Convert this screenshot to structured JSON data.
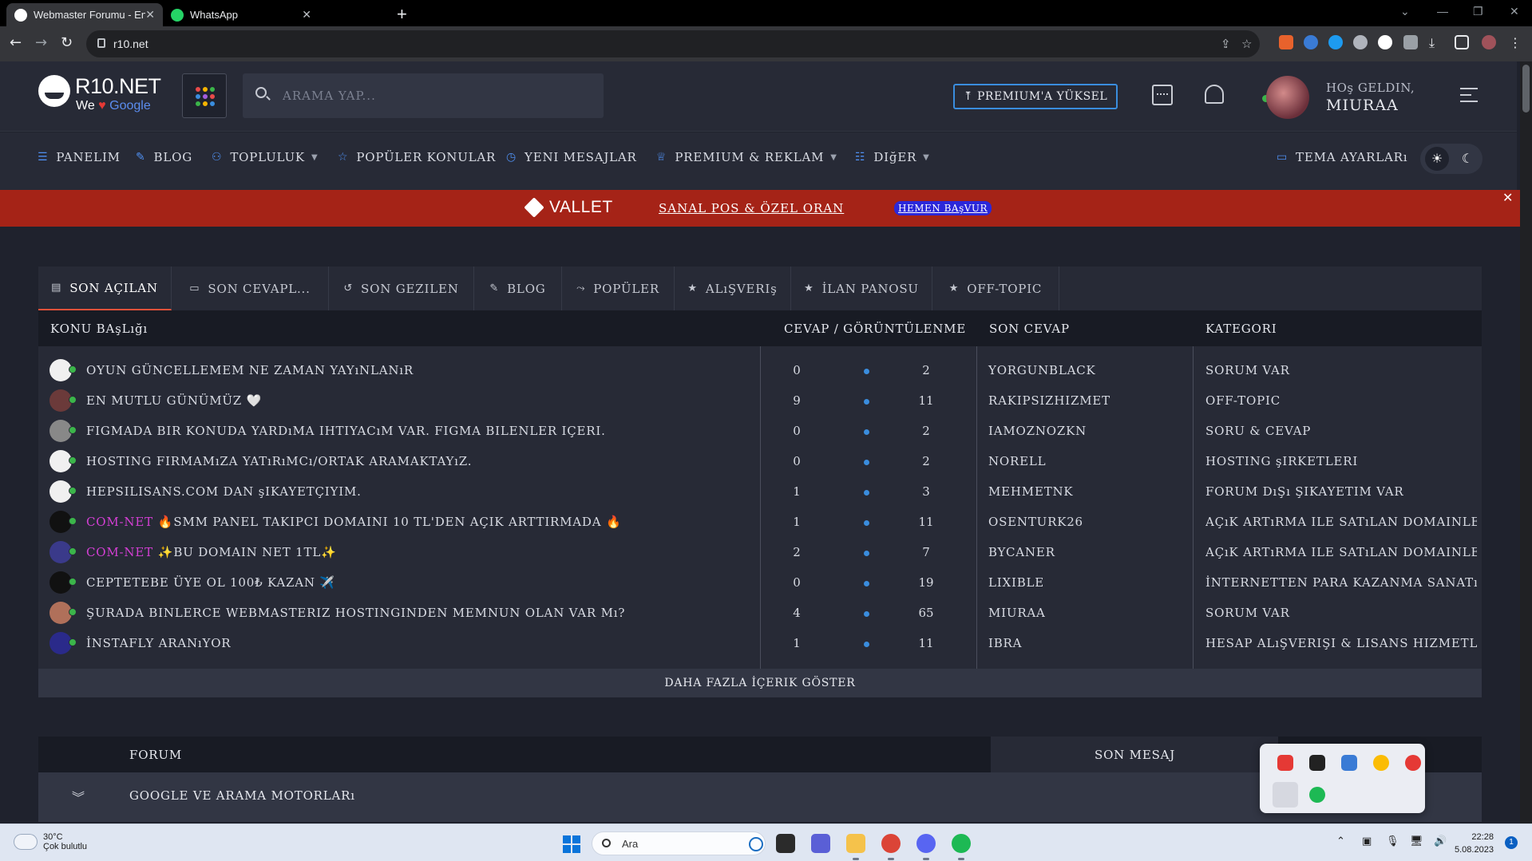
{
  "browser": {
    "tabs": [
      {
        "title": "Webmaster Forumu - En Büyük F",
        "active": true
      },
      {
        "title": "WhatsApp",
        "active": false
      }
    ],
    "address": "r10.net"
  },
  "site": {
    "logo": {
      "name": "R10.NET",
      "tagline_pre": "We",
      "tagline_heart": "♥",
      "tagline_post": "Google"
    },
    "search_placeholder": "ARAMA YAP...",
    "premium_button": "⤒ PREMIUM'A YÜKSEL",
    "greeting": "HOş GELDIN,",
    "username": "MIURAA"
  },
  "nav": {
    "items": [
      {
        "icon": "☰",
        "label": "PANELIM",
        "caret": false
      },
      {
        "icon": "✎",
        "label": "BLOG",
        "caret": false
      },
      {
        "icon": "⚇",
        "label": "TOPLULUK",
        "caret": true
      },
      {
        "icon": "☆",
        "label": "POPÜLER KONULAR",
        "caret": false
      },
      {
        "icon": "◷",
        "label": "YENI MESAJLAR",
        "caret": false
      },
      {
        "icon": "♕",
        "label": "PREMIUM & REKLAM",
        "caret": true
      },
      {
        "icon": "☷",
        "label": "DIğER",
        "caret": true
      }
    ],
    "theme_settings": "TEMA AYARLARı"
  },
  "promo": {
    "brand": "VALLET",
    "offer": "SANAL POS & ÖZEL ORAN",
    "cta": "HEMEN BAşVUR"
  },
  "content_tabs": [
    {
      "icon": "▤",
      "label": "SON AÇILAN"
    },
    {
      "icon": "▭",
      "label": "SON CEVAPL..."
    },
    {
      "icon": "↺",
      "label": "SON GEZILEN"
    },
    {
      "icon": "✎",
      "label": "BLOG"
    },
    {
      "icon": "⤳",
      "label": "POPÜLER"
    },
    {
      "icon": "★",
      "label": "ALıŞVERIş"
    },
    {
      "icon": "★",
      "label": "İLAN PANOSU"
    },
    {
      "icon": "★",
      "label": "OFF-TOPIC"
    }
  ],
  "table": {
    "headers": {
      "title": "KONU BAşLığı",
      "stats": "CEVAP / GÖRÜNTÜLENME",
      "last_reply": "SON CEVAP",
      "category": "KATEGORI"
    },
    "rows": [
      {
        "prefix": "",
        "title": "OYUN GÜNCELLEMEM NE ZAMAN YAYıNLANıR",
        "replies": "0",
        "views": "2",
        "last": "YORGUNBLACK",
        "category": "SORUM VAR",
        "avatar": "#f0f0f0"
      },
      {
        "prefix": "",
        "title": "EN MUTLU GÜNÜMÜZ 🤍",
        "replies": "9",
        "views": "11",
        "last": "RAKIPSIZHIZMET",
        "category": "OFF-TOPIC",
        "avatar": "#6b3a3a"
      },
      {
        "prefix": "",
        "title": "FIGMADA BIR KONUDA YARDıMA IHTIYACıM VAR. FIGMA BILENLER IÇERI.",
        "replies": "0",
        "views": "2",
        "last": "IAMOZNOZKN",
        "category": "SORU & CEVAP",
        "avatar": "#888"
      },
      {
        "prefix": "",
        "title": "HOSTING FIRMAMıZA YATıRıMCı/ORTAK ARAMAKTAYıZ.",
        "replies": "0",
        "views": "2",
        "last": "NORELL",
        "category": "HOSTING şIRKETLERI",
        "avatar": "#f0f0f0"
      },
      {
        "prefix": "",
        "title": "HEPSILISANS.COM DAN şIKAYETÇIYIM.",
        "replies": "1",
        "views": "3",
        "last": "MEHMETNK",
        "category": "FORUM DıŞı ŞIKAYETIM VAR",
        "avatar": "#f0f0f0"
      },
      {
        "prefix": "COM-NET",
        "title": "🔥SMM PANEL TAKIPCI DOMAINI 10 TL'DEN AÇIK ARTTIRMADA 🔥",
        "replies": "1",
        "views": "11",
        "last": "OSENTURK26",
        "category": "AÇıK ARTıRMA ILE SATıLAN DOMAINLER",
        "avatar": "#111"
      },
      {
        "prefix": "COM-NET",
        "title": "✨BU DOMAIN NET 1TL✨",
        "replies": "2",
        "views": "7",
        "last": "BYCANER",
        "category": "AÇıK ARTıRMA ILE SATıLAN DOMAINLER",
        "avatar": "#3a3a8a"
      },
      {
        "prefix": "",
        "title": "CEPTETEBE ÜYE OL 100₺ KAZAN ✈️",
        "replies": "0",
        "views": "19",
        "last": "LIXIBLE",
        "category": "İNTERNETTEN PARA KAZANMA SANATı",
        "avatar": "#111"
      },
      {
        "prefix": "",
        "title": "ŞURADA BINLERCE WEBMASTERIZ HOSTINGINDEN MEMNUN OLAN VAR Mı?",
        "replies": "4",
        "views": "65",
        "last": "MIURAA",
        "category": "SORUM VAR",
        "avatar": "#b0705a"
      },
      {
        "prefix": "",
        "title": "İNSTAFLY ARANıYOR",
        "replies": "1",
        "views": "11",
        "last": "IBRA",
        "category": "HESAP ALıŞVERIŞI & LISANS HIZMETLERI",
        "avatar": "#2a2a8a"
      }
    ],
    "more": "DAHA FAZLA İÇERIK GÖSTER"
  },
  "forum": {
    "head_forum": "FORUM",
    "head_last": "SON MESAJ",
    "section": "GOOGLE VE ARAMA MOTORLARı",
    "expand_icon": "»"
  },
  "taskbar": {
    "temp": "30°C",
    "condition": "Çok bulutlu",
    "search": "Ara",
    "time": "22:28",
    "date": "5.08.2023",
    "notifications": "1"
  },
  "colors": {
    "accent": "#3a8dde",
    "promo": "#a52317",
    "prefix": "#d43fd4",
    "online": "#3bb54a"
  }
}
